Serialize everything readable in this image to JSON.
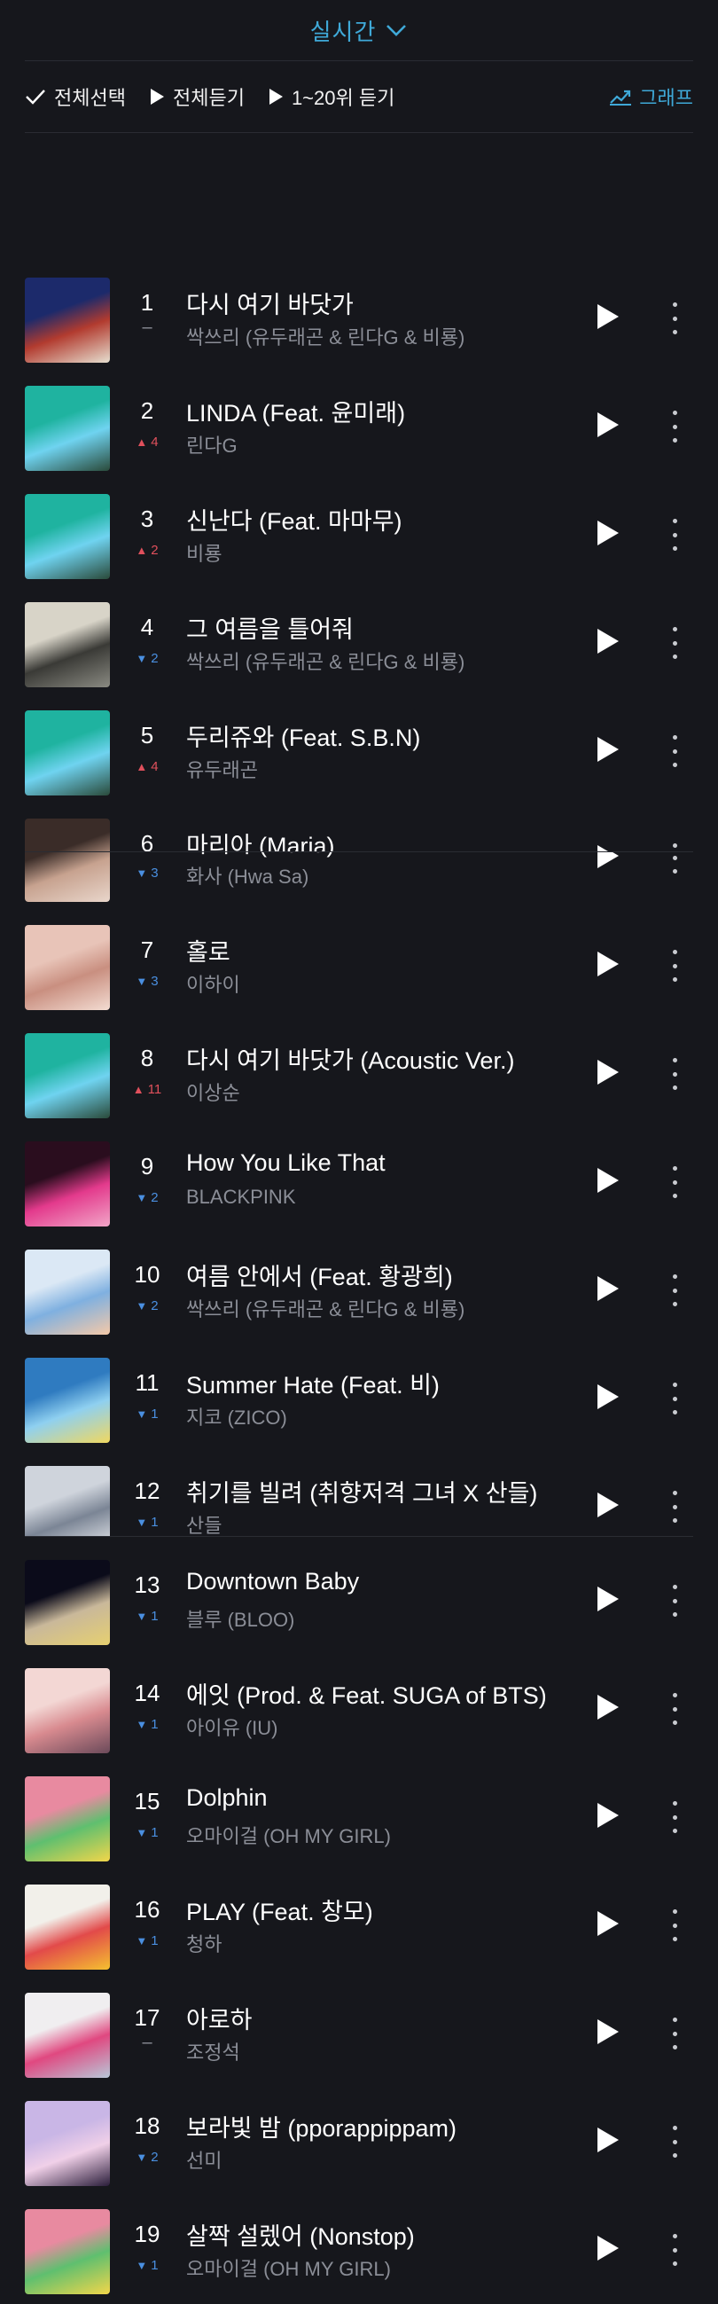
{
  "header": {
    "title": "실시간"
  },
  "actions": {
    "select_all": "전체선택",
    "play_all": "전체듣기",
    "play_top": "1~20위 듣기",
    "graph": "그래프"
  },
  "chart": [
    {
      "rank": "1",
      "change": "–",
      "dir": "same",
      "title": "다시 여기 바닷가",
      "artist": "싹쓰리 (유두래곤 & 린다G & 비룡)"
    },
    {
      "rank": "2",
      "change": "4",
      "dir": "up",
      "title": "LINDA (Feat. 윤미래)",
      "artist": "린다G"
    },
    {
      "rank": "3",
      "change": "2",
      "dir": "up",
      "title": "신난다 (Feat. 마마무)",
      "artist": "비룡"
    },
    {
      "rank": "4",
      "change": "2",
      "dir": "down",
      "title": "그 여름을 틀어줘",
      "artist": "싹쓰리 (유두래곤 & 린다G & 비룡)"
    },
    {
      "rank": "5",
      "change": "4",
      "dir": "up",
      "title": "두리쥬와 (Feat. S.B.N)",
      "artist": "유두래곤"
    },
    {
      "rank": "6",
      "change": "3",
      "dir": "down",
      "title": "마리아 (Maria)",
      "artist": "화사 (Hwa Sa)"
    },
    {
      "rank": "7",
      "change": "3",
      "dir": "down",
      "title": "홀로",
      "artist": "이하이"
    },
    {
      "rank": "8",
      "change": "11",
      "dir": "up",
      "title": "다시 여기 바닷가 (Acoustic Ver.)",
      "artist": "이상순"
    },
    {
      "rank": "9",
      "change": "2",
      "dir": "down",
      "title": "How You Like That",
      "artist": "BLACKPINK"
    },
    {
      "rank": "10",
      "change": "2",
      "dir": "down",
      "title": "여름 안에서 (Feat. 황광희)",
      "artist": "싹쓰리 (유두래곤 & 린다G & 비룡)"
    },
    {
      "rank": "11",
      "change": "1",
      "dir": "down",
      "title": "Summer Hate (Feat. 비)",
      "artist": "지코 (ZICO)"
    },
    {
      "rank": "12",
      "change": "1",
      "dir": "down",
      "title": "취기를 빌려 (취향저격 그녀 X 산들)",
      "artist": "산들"
    },
    {
      "rank": "13",
      "change": "1",
      "dir": "down",
      "title": "Downtown Baby",
      "artist": "블루 (BLOO)"
    },
    {
      "rank": "14",
      "change": "1",
      "dir": "down",
      "title": "에잇 (Prod. & Feat. SUGA of BTS)",
      "artist": "아이유 (IU)"
    },
    {
      "rank": "15",
      "change": "1",
      "dir": "down",
      "title": "Dolphin",
      "artist": "오마이걸 (OH MY GIRL)"
    },
    {
      "rank": "16",
      "change": "1",
      "dir": "down",
      "title": "PLAY (Feat. 창모)",
      "artist": "청하"
    },
    {
      "rank": "17",
      "change": "–",
      "dir": "same",
      "title": "아로하",
      "artist": "조정석"
    },
    {
      "rank": "18",
      "change": "2",
      "dir": "down",
      "title": "보라빛 밤 (pporappippam)",
      "artist": "선미"
    },
    {
      "rank": "19",
      "change": "1",
      "dir": "down",
      "title": "살짝 설렜어 (Nonstop)",
      "artist": "오마이걸 (OH MY GIRL)"
    }
  ],
  "colors": {
    "accent": "#3fa9d8",
    "up": "#e0505c",
    "down": "#4a8fe0",
    "bg": "#16171c"
  }
}
